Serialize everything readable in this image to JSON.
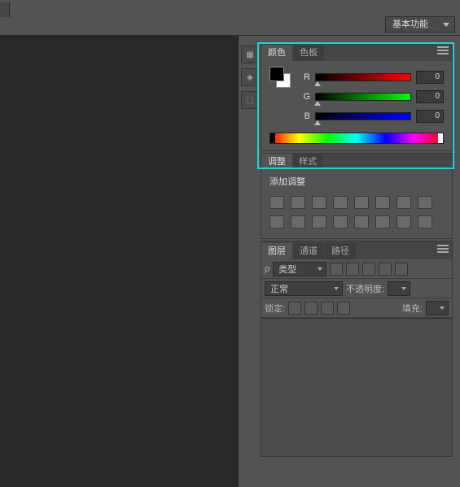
{
  "topbar": {
    "workspace": "基本功能"
  },
  "color_panel": {
    "tabs": {
      "color": "颜色",
      "swatches": "色板"
    },
    "channels": {
      "r_label": "R",
      "g_label": "G",
      "b_label": "B"
    },
    "values": {
      "r": "0",
      "g": "0",
      "b": "0"
    }
  },
  "adjust_panel": {
    "tabs": {
      "adjust": "调整",
      "styles": "样式"
    },
    "title": "添加调整"
  },
  "layers_panel": {
    "tabs": {
      "layers": "图层",
      "channels": "通道",
      "paths": "路径"
    },
    "kind_label": "类型",
    "blend_mode": "正常",
    "opacity_label": "不透明度:",
    "lock_label": "锁定:",
    "fill_label": "填充:"
  }
}
